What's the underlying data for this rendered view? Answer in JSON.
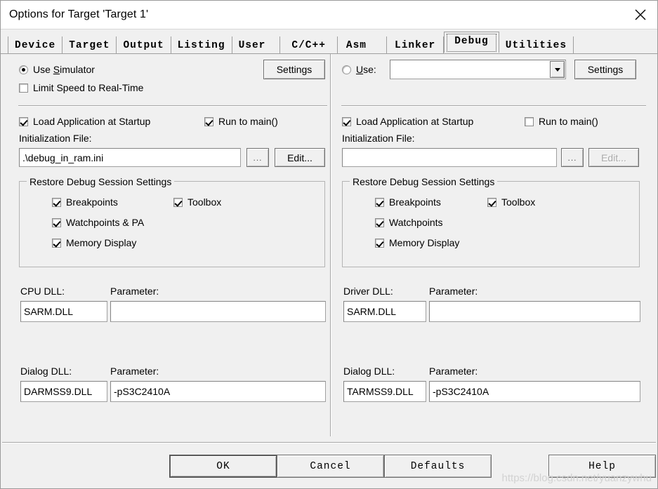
{
  "window": {
    "title": "Options for Target 'Target 1'",
    "close_icon": "close-icon",
    "bg_color": "#f0f0f0",
    "titlebar_color": "#ffffff"
  },
  "tabs": [
    {
      "label": "Device",
      "active": false
    },
    {
      "label": "Target",
      "active": false
    },
    {
      "label": "Output",
      "active": false
    },
    {
      "label": "Listing",
      "active": false
    },
    {
      "label": "User",
      "active": false
    },
    {
      "label": "C/C++",
      "active": false
    },
    {
      "label": "Asm",
      "active": false
    },
    {
      "label": "Linker",
      "active": false
    },
    {
      "label": "Debug",
      "active": true
    },
    {
      "label": "Utilities",
      "active": false
    }
  ],
  "left_panel": {
    "mode_radio": {
      "label_pre": "Use ",
      "label_accel": "S",
      "label_post": "imulator",
      "checked": true
    },
    "settings_button": "Settings",
    "limit_speed": {
      "label": "Limit Speed to Real-Time",
      "checked": false
    },
    "load_application": {
      "label": "Load Application at Startup",
      "checked": true
    },
    "run_to_main": {
      "label": "Run to main()",
      "checked": true
    },
    "init_file_label": "Initialization File:",
    "init_file_value": ".\\debug_in_ram.ini",
    "browse_button": "...",
    "edit_button": "Edit...",
    "edit_button_disabled": false,
    "restore_group": {
      "title": "Restore Debug Session Settings",
      "breakpoints": {
        "label": "Breakpoints",
        "checked": true
      },
      "toolbox": {
        "label": "Toolbox",
        "checked": true
      },
      "watchpoints": {
        "label": "Watchpoints & PA",
        "checked": true
      },
      "memory_display": {
        "label": "Memory Display",
        "checked": true
      }
    },
    "dll_label": "CPU DLL:",
    "dll_value": "SARM.DLL",
    "dll_param_label": "Parameter:",
    "dll_param_value": "",
    "dialog_dll_label": "Dialog DLL:",
    "dialog_dll_value": "DARMSS9.DLL",
    "dialog_param_label": "Parameter:",
    "dialog_param_value": "-pS3C2410A"
  },
  "right_panel": {
    "mode_radio": {
      "label_accel": "U",
      "label_post": "se:",
      "checked": false
    },
    "driver_combo_value": "",
    "driver_combo_arrow_icon": "chevron-down-icon",
    "settings_button": "Settings",
    "load_application": {
      "label": "Load Application at Startup",
      "checked": true
    },
    "run_to_main": {
      "label": "Run to main()",
      "checked": false
    },
    "init_file_label": "Initialization File:",
    "init_file_value": "",
    "browse_button": "...",
    "edit_button": "Edit...",
    "edit_button_disabled": true,
    "restore_group": {
      "title": "Restore Debug Session Settings",
      "breakpoints": {
        "label": "Breakpoints",
        "checked": true
      },
      "toolbox": {
        "label": "Toolbox",
        "checked": true
      },
      "watchpoints": {
        "label": "Watchpoints",
        "checked": true
      },
      "memory_display": {
        "label": "Memory Display",
        "checked": true
      }
    },
    "dll_label": "Driver DLL:",
    "dll_value": "SARM.DLL",
    "dll_param_label": "Parameter:",
    "dll_param_value": "",
    "dialog_dll_label": "Dialog DLL:",
    "dialog_dll_value": "TARMSS9.DLL",
    "dialog_param_label": "Parameter:",
    "dialog_param_value": "-pS3C2410A"
  },
  "footer": {
    "ok": "OK",
    "cancel": "Cancel",
    "defaults": "Defaults",
    "help": "Help",
    "watermark": "https://blog.csdn.net/yuanzywhu"
  }
}
